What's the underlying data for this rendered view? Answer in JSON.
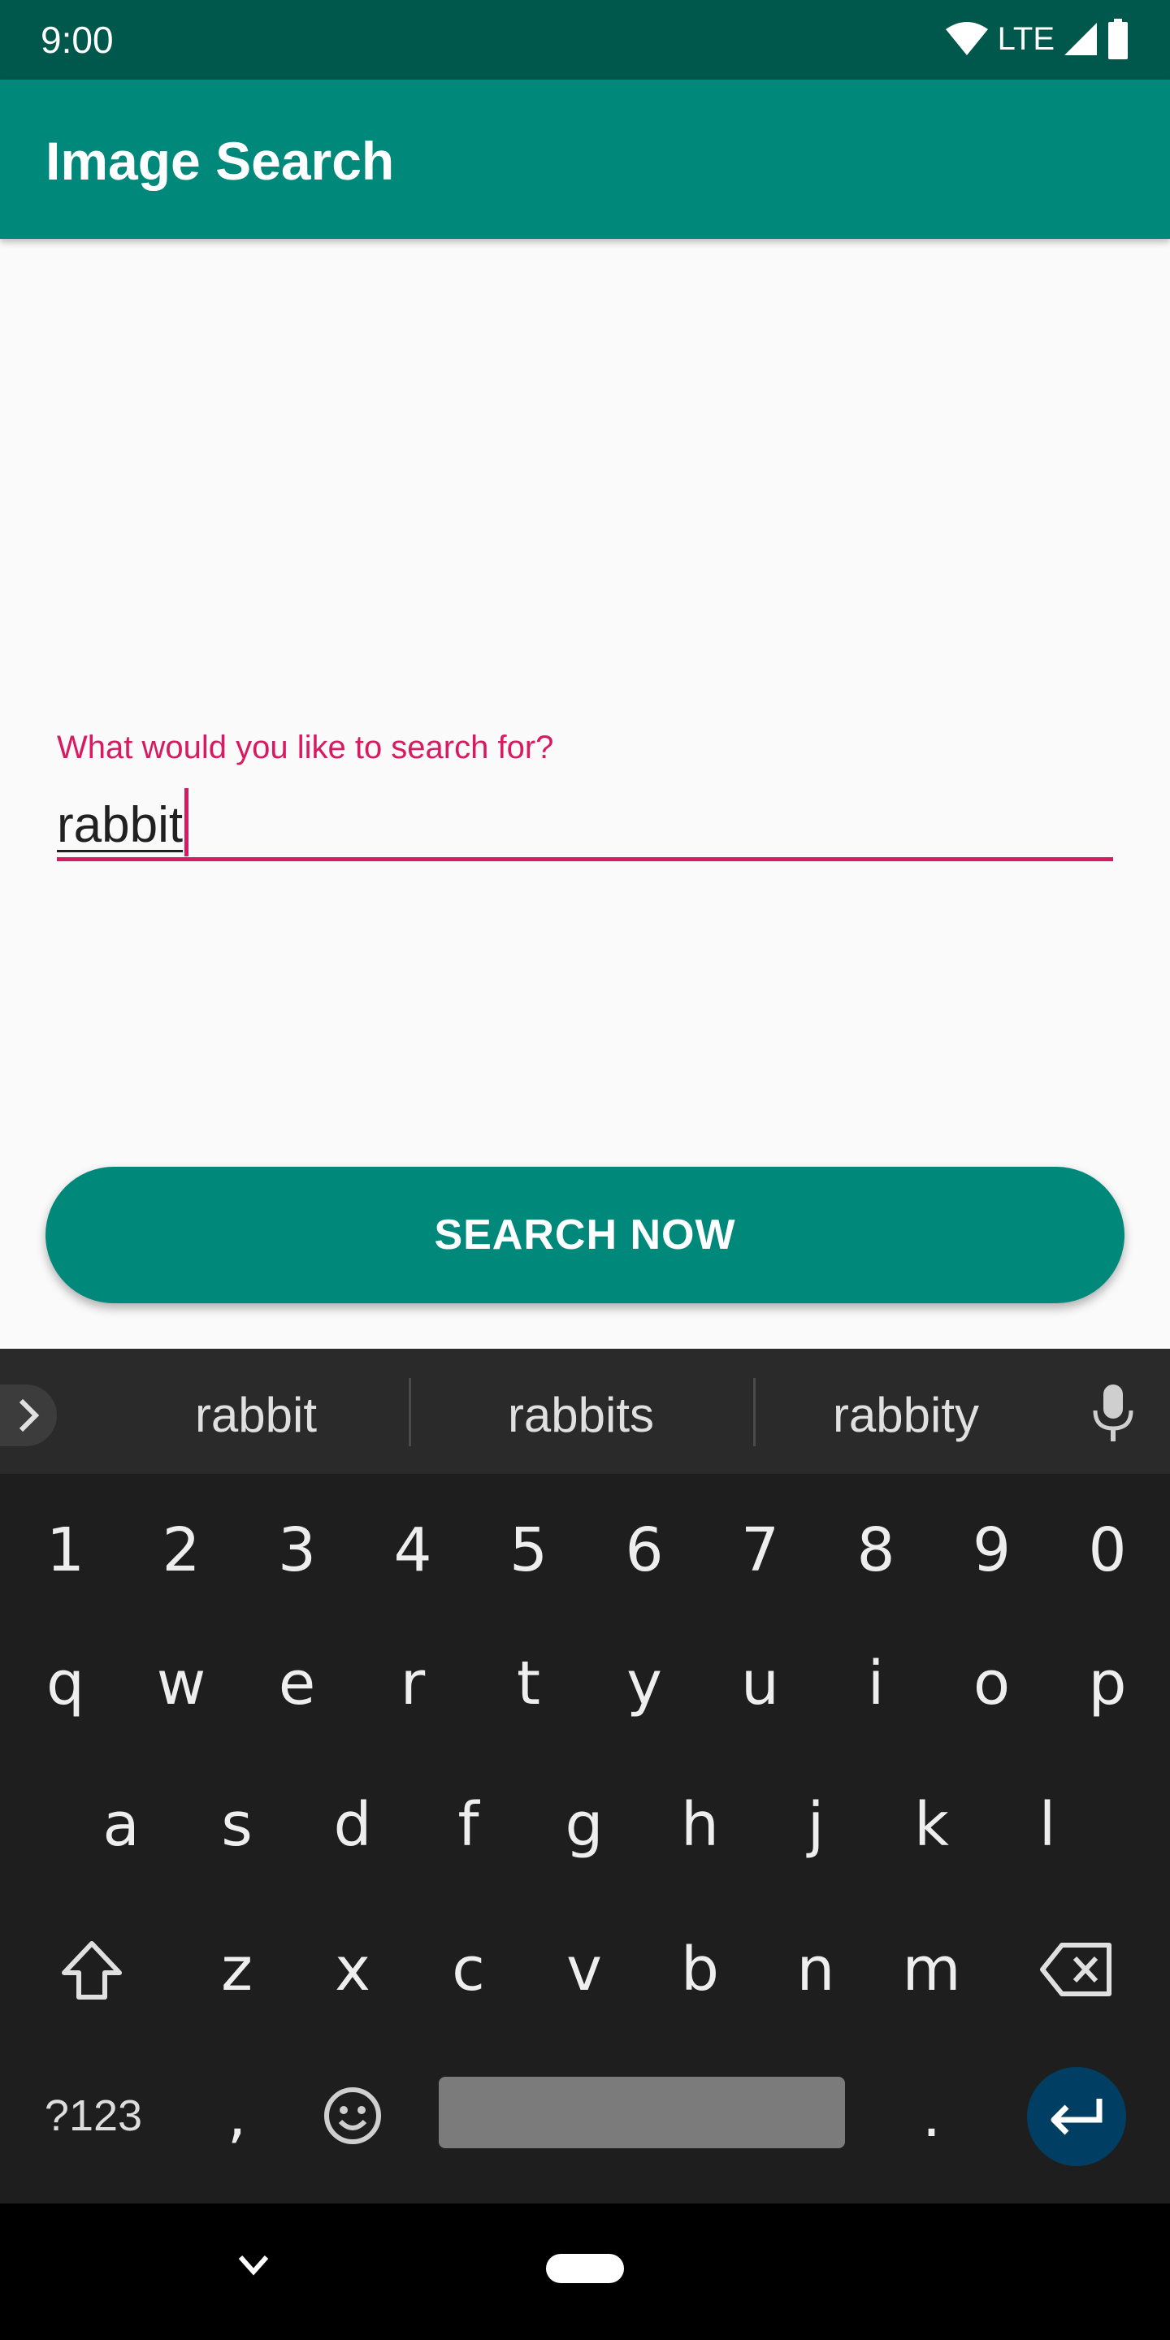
{
  "status_bar": {
    "time": "9:00",
    "network": "LTE",
    "icons": [
      "wifi-icon",
      "cell-signal-icon",
      "battery-icon"
    ]
  },
  "app_bar": {
    "title": "Image Search"
  },
  "search": {
    "label": "What would you like to search for?",
    "value": "rabbit"
  },
  "button": {
    "label": "SEARCH NOW"
  },
  "keyboard": {
    "suggestions": [
      "rabbit",
      "rabbits",
      "rabbity"
    ],
    "row_numbers": [
      "1",
      "2",
      "3",
      "4",
      "5",
      "6",
      "7",
      "8",
      "9",
      "0"
    ],
    "row_top": [
      "q",
      "w",
      "e",
      "r",
      "t",
      "y",
      "u",
      "i",
      "o",
      "p"
    ],
    "row_middle": [
      "a",
      "s",
      "d",
      "f",
      "g",
      "h",
      "j",
      "k",
      "l"
    ],
    "row_bottom": [
      "z",
      "x",
      "c",
      "v",
      "b",
      "n",
      "m"
    ],
    "symbols_label": "?123",
    "comma": ",",
    "period": "."
  },
  "colors": {
    "primary": "#00897b",
    "primary_dark": "#00574b",
    "accent": "#d81b60",
    "keyboard_bg": "#1e1e1e"
  }
}
